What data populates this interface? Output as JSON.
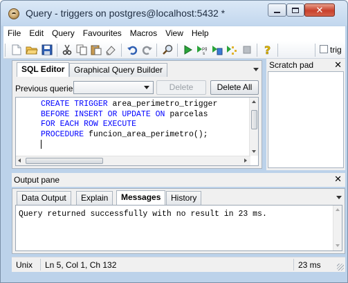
{
  "window": {
    "title": "Query - triggers on postgres@localhost:5432 *",
    "close_glyph": "✕"
  },
  "menu": [
    "File",
    "Edit",
    "Query",
    "Favourites",
    "Macros",
    "View",
    "Help"
  ],
  "toolbar": {
    "icons": [
      "new-file-icon",
      "open-folder-icon",
      "save-icon",
      "cut-icon",
      "copy-icon",
      "paste-icon",
      "clear-icon",
      "undo-icon",
      "redo-icon",
      "find-icon",
      "execute-icon",
      "execute-pgscript-icon",
      "execute-to-file-icon",
      "explain-icon",
      "cancel-icon",
      "help-icon"
    ],
    "trigger_checkbox_label": "trig"
  },
  "sql_pane": {
    "tabs": [
      {
        "label": "SQL Editor",
        "active": true
      },
      {
        "label": "Graphical Query Builder",
        "active": false
      }
    ],
    "previous_queries_label": "Previous queries",
    "previous_queries_value": "",
    "delete_label": "Delete",
    "delete_all_label": "Delete All",
    "code_lines": [
      [
        {
          "t": "CREATE TRIGGER",
          "kw": true
        },
        {
          "t": " area_perimetro_trigger",
          "kw": false
        }
      ],
      [
        {
          "t": "BEFORE INSERT OR UPDATE ON",
          "kw": true
        },
        {
          "t": " parcelas",
          "kw": false
        }
      ],
      [
        {
          "t": "FOR EACH ROW EXECUTE",
          "kw": true
        }
      ],
      [
        {
          "t": "PROCEDURE",
          "kw": true
        },
        {
          "t": " funcion_area_perimetro();",
          "kw": false
        }
      ],
      []
    ]
  },
  "scratch_pad": {
    "title": "Scratch pad",
    "close_glyph": "✕"
  },
  "output_pane": {
    "title": "Output pane",
    "close_glyph": "✕",
    "tabs": [
      {
        "label": "Data Output",
        "active": false
      },
      {
        "label": "Explain",
        "active": false
      },
      {
        "label": "Messages",
        "active": true
      },
      {
        "label": "History",
        "active": false
      }
    ],
    "message": "Query returned successfully with no result in 23 ms."
  },
  "status_bar": {
    "encoding": "Unix",
    "position": "Ln 5, Col 1, Ch 132",
    "duration": "23 ms"
  }
}
